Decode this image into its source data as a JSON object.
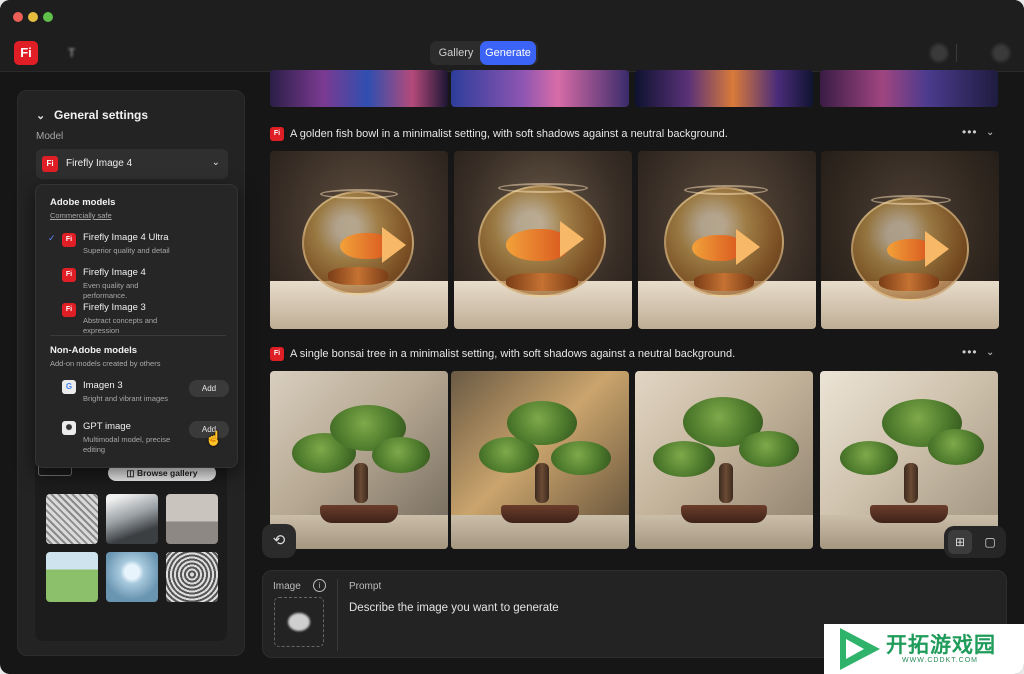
{
  "window": {
    "controls": [
      "close",
      "minimize",
      "maximize"
    ]
  },
  "header": {
    "logo": "Fi",
    "app_title": "T",
    "tabs": [
      {
        "label": "Gallery",
        "active": false
      },
      {
        "label": "Generate",
        "active": true
      }
    ],
    "accent_color": "#3b63f5"
  },
  "left_panel": {
    "section_title": "General settings",
    "model_label": "Model",
    "selected_model": "Firefly Image 4",
    "browse_gallery_label": "Browse gallery"
  },
  "model_dropdown": {
    "adobe_title": "Adobe models",
    "adobe_subtitle": "Commercially safe",
    "adobe_models": [
      {
        "name": "Firefly Image 4 Ultra",
        "desc": "Superior quality and detail",
        "selected": true
      },
      {
        "name": "Firefly Image 4",
        "desc": "Even quality and performance.",
        "selected": false
      },
      {
        "name": "Firefly Image 3",
        "desc": "Abstract concepts and expression",
        "selected": false
      }
    ],
    "nonadobe_title": "Non-Adobe models",
    "nonadobe_subtitle": "Add-on models created by others",
    "partner_models": [
      {
        "name": "Imagen 3",
        "desc": "Bright and vibrant images",
        "action": "Add",
        "icon": "G"
      },
      {
        "name": "GPT image",
        "desc": "Multimodal model, precise editing",
        "action": "Add",
        "icon": "✺"
      }
    ]
  },
  "feed": {
    "generations": [
      {
        "prompt": "A golden fish bowl in a minimalist setting, with soft shadows against a neutral background.",
        "image_count": 4
      },
      {
        "prompt": "A single bonsai tree in a minimalist setting, with soft shadows against a neutral background.",
        "image_count": 4
      }
    ],
    "more_icon": "•••",
    "expand_icon": "⌄"
  },
  "prompt_bar": {
    "image_label": "Image",
    "prompt_label": "Prompt",
    "placeholder": "Describe the image you want to generate"
  },
  "watermark": {
    "brand": "开拓游戏园",
    "url": "WWW.CDDKT.COM"
  }
}
